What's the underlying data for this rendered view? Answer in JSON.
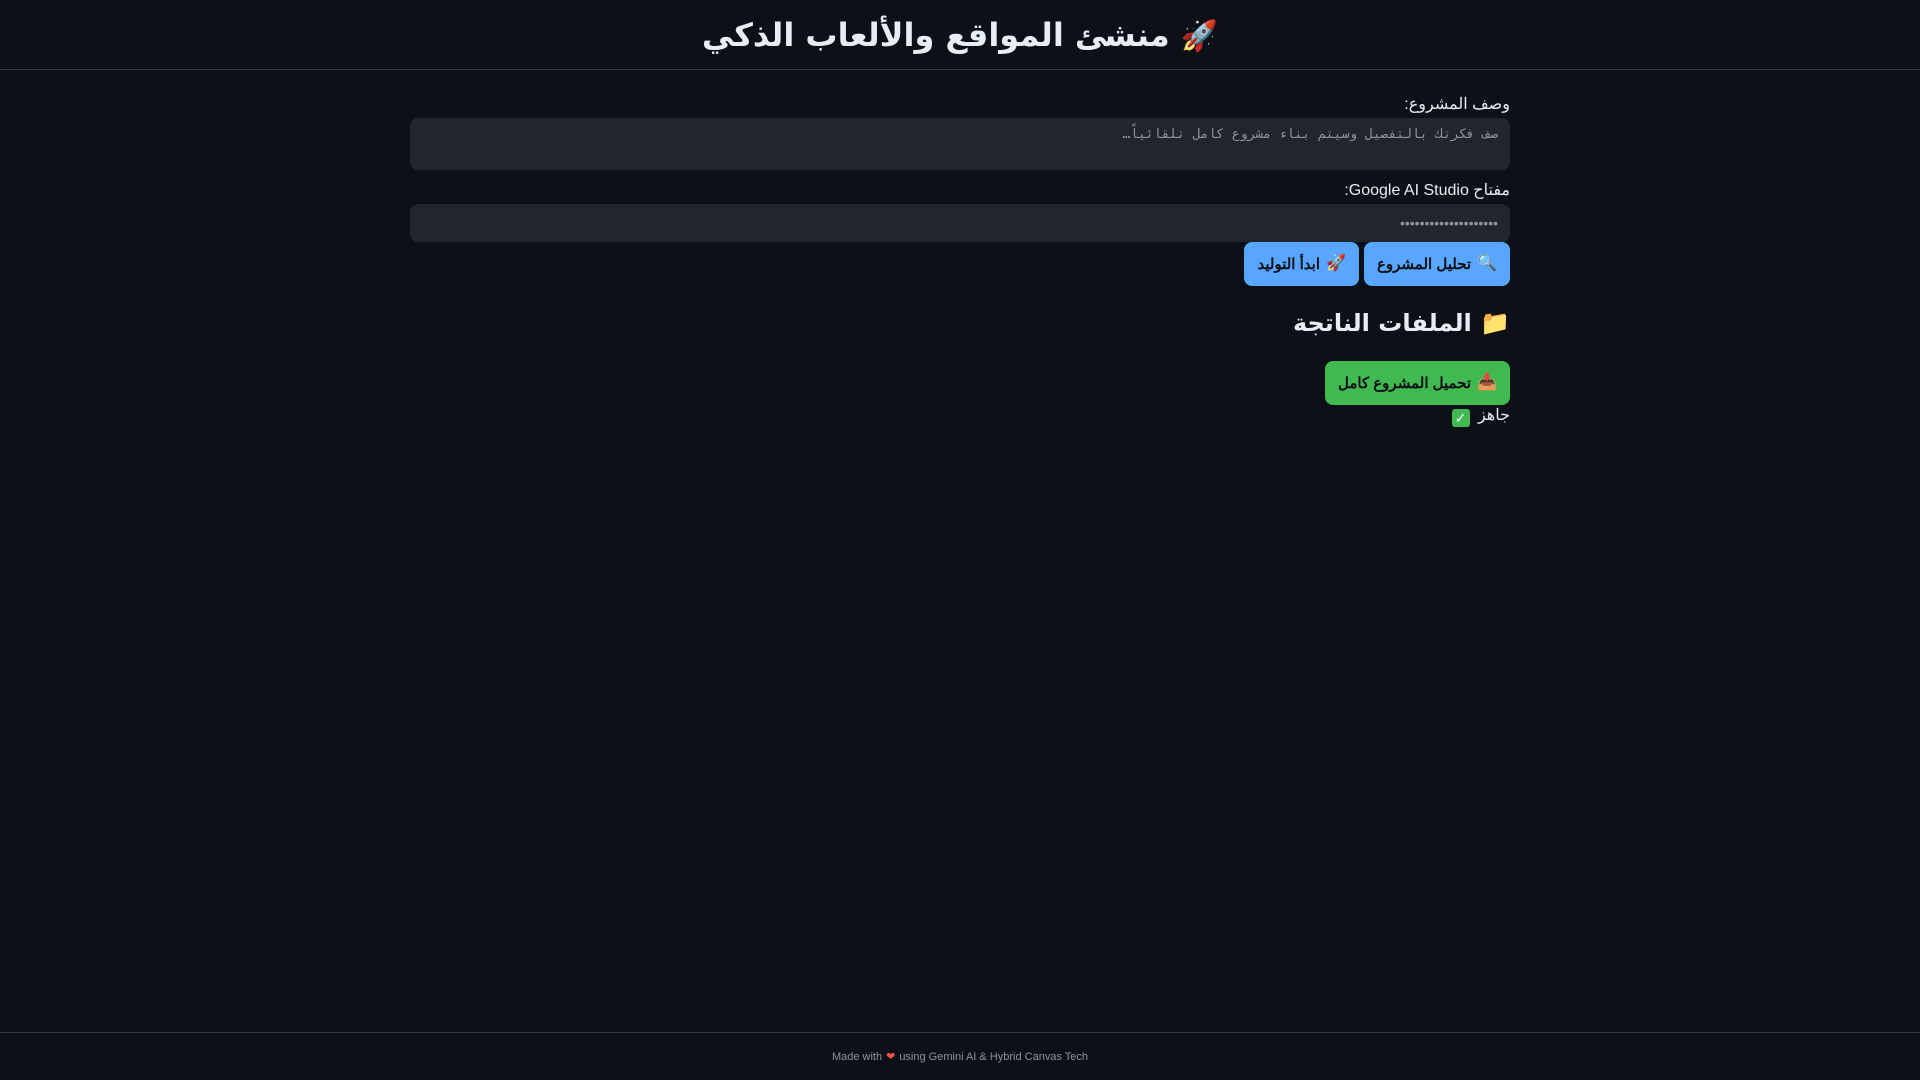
{
  "header": {
    "title": "منشئ المواقع والألعاب الذكي",
    "icon": "rocket-icon"
  },
  "form": {
    "description_label": "وصف المشروع:",
    "description_placeholder": "صف فكرتك بالتفصيل وسيتم بناء مشروع كامل تلقائياً…",
    "description_value": "",
    "api_key_label": "مفتاح Google AI Studio:",
    "api_key_placeholder": "••••••••••••••••••••",
    "api_key_value": ""
  },
  "actions": {
    "analyze_label": "تحليل المشروع",
    "analyze_icon": "magnifier-icon",
    "generate_label": "ابدأ التوليد",
    "generate_icon": "rocket-icon"
  },
  "output": {
    "section_title": "الملفات الناتجة",
    "section_icon": "folder-icon",
    "download_label": "تحميل المشروع كامل",
    "download_icon": "inbox-tray-icon",
    "status_text": "جاهز"
  },
  "footer": {
    "made_with": "Made with",
    "using_text": "using Gemini AI & Hybrid Canvas Tech"
  },
  "colors": {
    "background": "#0d1117",
    "input_bg": "#21262d",
    "primary_blue": "#58a6ff",
    "success_green": "#3fb950",
    "text": "#e6edf3",
    "muted": "#8b949e"
  }
}
